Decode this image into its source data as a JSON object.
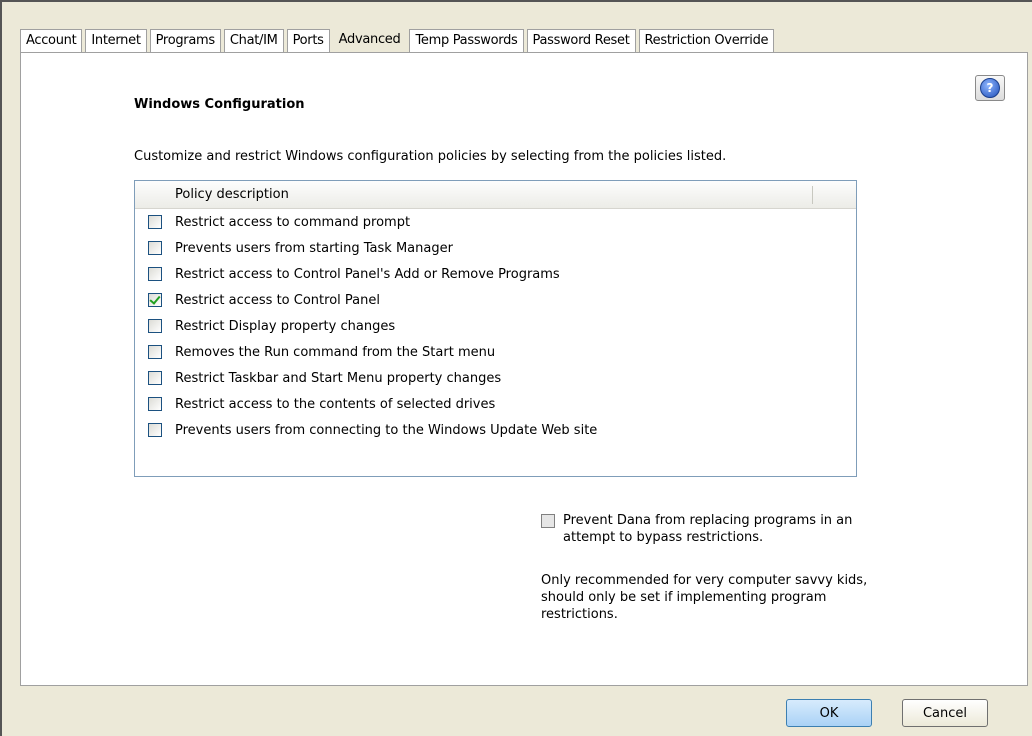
{
  "tabs": [
    {
      "label": "Account",
      "active": false
    },
    {
      "label": "Internet",
      "active": false
    },
    {
      "label": "Programs",
      "active": false
    },
    {
      "label": "Chat/IM",
      "active": false
    },
    {
      "label": "Ports",
      "active": false
    },
    {
      "label": "Advanced",
      "active": true
    },
    {
      "label": "Temp Passwords",
      "active": false
    },
    {
      "label": "Password Reset",
      "active": false
    },
    {
      "label": "Restriction Override",
      "active": false
    }
  ],
  "help_icon": "help-question-icon",
  "section": {
    "title": "Windows Configuration",
    "description": "Customize and restrict Windows configuration policies by selecting from the policies listed."
  },
  "policy_list": {
    "column_header": "Policy description",
    "items": [
      {
        "label": "Restrict access to command prompt",
        "checked": false
      },
      {
        "label": "Prevents users from starting Task Manager",
        "checked": false
      },
      {
        "label": "Restrict access to Control Panel's Add or Remove Programs",
        "checked": false
      },
      {
        "label": "Restrict access to Control Panel",
        "checked": true
      },
      {
        "label": "Restrict Display property changes",
        "checked": false
      },
      {
        "label": "Removes the Run command from the Start menu",
        "checked": false
      },
      {
        "label": "Restrict Taskbar and Start Menu property changes",
        "checked": false
      },
      {
        "label": "Restrict access to the contents of selected drives",
        "checked": false
      },
      {
        "label": "Prevents users from connecting to the Windows Update Web site",
        "checked": false
      }
    ]
  },
  "prevent_replacing": {
    "label": "Prevent Dana from replacing programs in an attempt to bypass restrictions.",
    "checked": false
  },
  "note": "Only recommended for very computer savvy kids, should only be set if implementing program restrictions.",
  "buttons": {
    "ok": "OK",
    "cancel": "Cancel"
  }
}
